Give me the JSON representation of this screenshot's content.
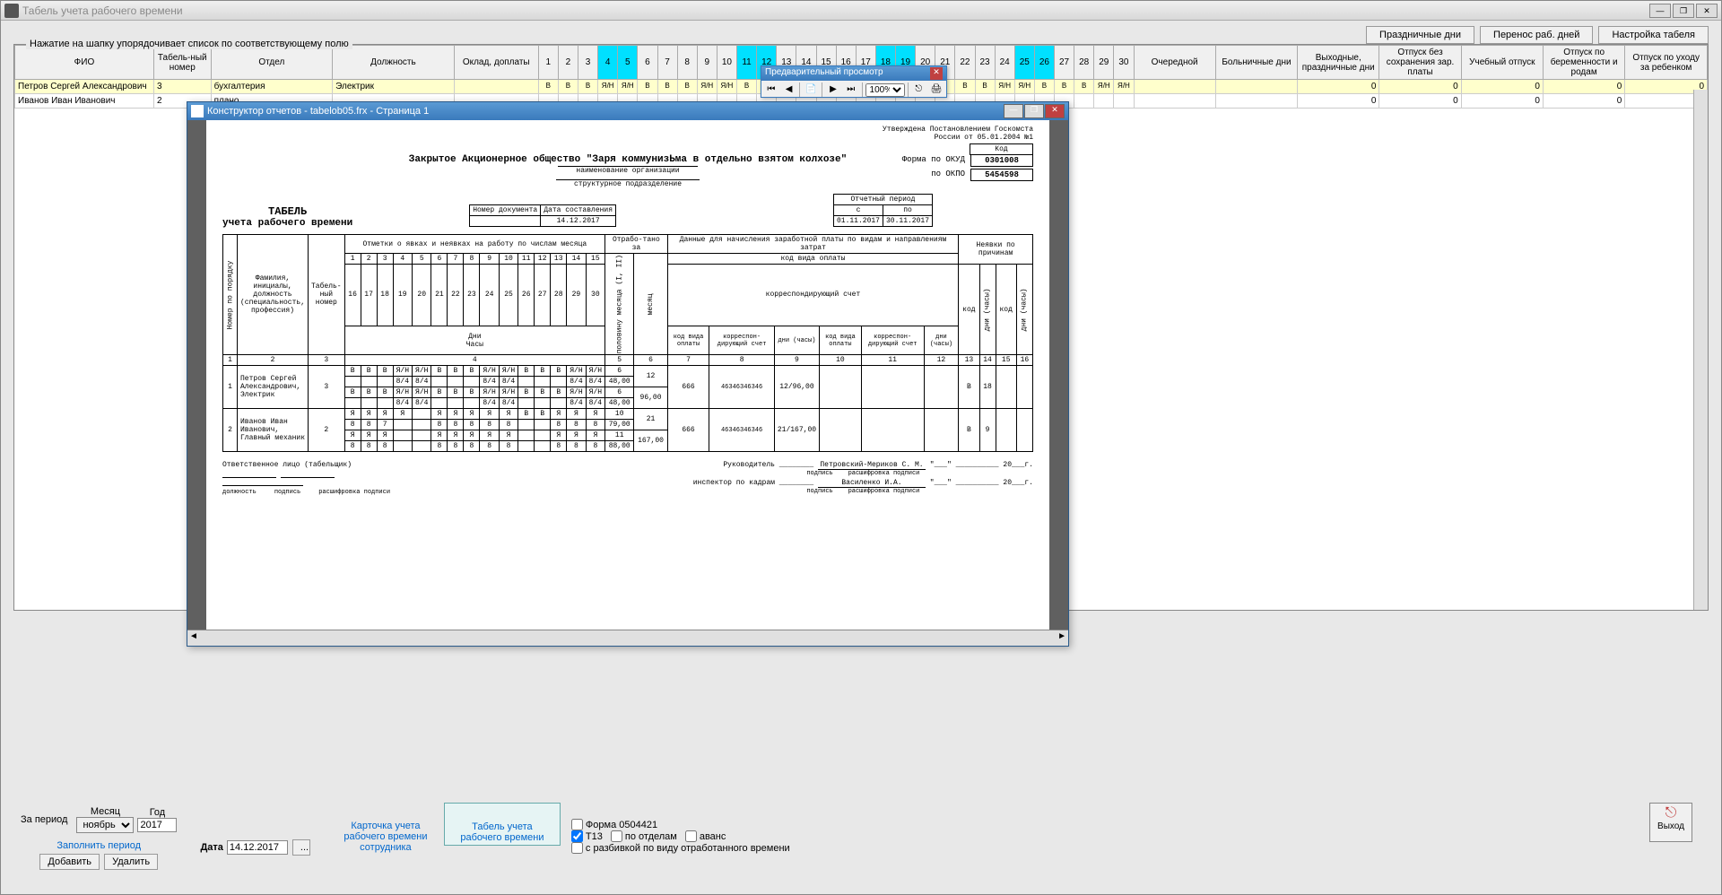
{
  "window": {
    "title": "Табель учета рабочего времени"
  },
  "topButtons": {
    "holidays": "Праздничные дни",
    "transfer": "Перенос раб. дней",
    "settings": "Настройка табеля"
  },
  "gridHint": "Нажатие на шапку упорядочивает список по соответствующему полю",
  "columns": {
    "fio": "ФИО",
    "tabnum": "Табель-ный номер",
    "dept": "Отдел",
    "position": "Должность",
    "salary": "Оклад, доплаты",
    "vacation": "Очередной",
    "sick": "Больничные дни",
    "weekend": "Выходные, праздничные дни",
    "unpaid": "Отпуск без сохранения зар. платы",
    "study": "Учебный отпуск",
    "maternity": "Отпуск по беременности и родам",
    "childcare": "Отпуск по уходу за ребенком"
  },
  "days": [
    "1",
    "2",
    "3",
    "4",
    "5",
    "6",
    "7",
    "8",
    "9",
    "10",
    "11",
    "12",
    "13",
    "14",
    "15",
    "16",
    "17",
    "18",
    "19",
    "20",
    "21",
    "22",
    "23",
    "24",
    "25",
    "26",
    "27",
    "28",
    "29",
    "30"
  ],
  "weekendDays": [
    4,
    5,
    11,
    12,
    18,
    19,
    25,
    26
  ],
  "rows": [
    {
      "fio": "Петров Сергей Александрович",
      "tabnum": "3",
      "dept": "бухгалтерия",
      "position": "Электрик",
      "marks": [
        "В",
        "В",
        "В",
        "Я/Н",
        "Я/Н",
        "В",
        "В",
        "В",
        "Я/Н",
        "Я/Н",
        "В",
        "В",
        "В",
        "Я/Н",
        "Я/Н",
        "В",
        "В",
        "В",
        "Я/Н",
        "Я/Н",
        "В",
        "В",
        "В",
        "Я/Н",
        "Я/Н",
        "В",
        "В",
        "В",
        "Я/Н",
        "Я/Н"
      ],
      "cats": [
        "",
        "",
        "0",
        "0",
        "0",
        "0",
        "0"
      ]
    },
    {
      "fio": "Иванов Иван Иванович",
      "tabnum": "2",
      "dept": "плано",
      "position": "",
      "marks": [
        "",
        "",
        "",
        "",
        "",
        "",
        "",
        "",
        "",
        "",
        "",
        "",
        "",
        "",
        "",
        "",
        "",
        "",
        "",
        "",
        "",
        "",
        "",
        "",
        "",
        "",
        "",
        "",
        "",
        ""
      ],
      "cats": [
        "",
        "",
        "0",
        "0",
        "0",
        "0",
        "0"
      ]
    }
  ],
  "period": {
    "label": "За период",
    "monthLabel": "Месяц",
    "yearLabel": "Год",
    "month": "ноябрь",
    "year": "2017",
    "fillBtn": "Заполнить период",
    "addBtn": "Добавить",
    "delBtn": "Удалить",
    "dateLabel": "Дата",
    "date": "14.12.2017",
    "ellipsis": "...",
    "cardLink": "Карточка учета рабочего времени сотрудника",
    "tabelLink": "Табель учета рабочего времени",
    "form": "Форма 0504421",
    "t13": "Т13",
    "byDept": "по отделам",
    "advance": "аванс",
    "byType": "с разбивкой по виду отработанного времени",
    "exit": "Выход"
  },
  "previewToolbar": {
    "title": "Предварительный просмотр",
    "zoom": "100%"
  },
  "reportWindow": {
    "title": "Конструктор отчетов - tabelob05.frx - Страница 1"
  },
  "report": {
    "approval1": "Утверждена Постановлением Госкомста",
    "approval2": "России от 05.01.2004 №1",
    "codeLabel": "Код",
    "okudLabel": "Форма по ОКУД",
    "okud": "0301008",
    "okpoLabel": "по ОКПО",
    "okpo": "5454598",
    "org": "Закрытое Акционерное общество \"Заря коммунизЬма в отдельно взятом колхозе\"",
    "orgSub": "наименование организации",
    "deptSub": "структурное подразделение",
    "title": "ТАБЕЛЬ",
    "subtitle": "учета рабочего времени",
    "docNumHdr": "Номер документа",
    "docDateHdr": "Дата составления",
    "periodHdr": "Отчетный период",
    "periodFrom": "с",
    "periodTo": "по",
    "docDate": "14.12.2017",
    "dateFrom": "01.11.2017",
    "dateTo": "30.11.2017",
    "thOrder": "Номер по порядку",
    "thFio": "Фамилия, инициалы, должность (специальность, профессия)",
    "thTabNum": "Табель-ный номер",
    "thMarks": "Отметки о явках и неявках на работу по числам месяца",
    "thWorked": "Отрабо-тано за",
    "thHalf": "половину месяца (I, II)",
    "thMonth": "месяц",
    "thPayData": "Данные для начисления заработной платы по видам и направлениям затрат",
    "thPayCode": "код вида оплаты",
    "thCorrAcct": "корреспондирующий счет",
    "thDays": "Дни",
    "thHours": "Часы",
    "thPayCode2": "код вида оплаты",
    "thCorr2": "корреспон-дирующий счет",
    "thDaysHours": "дни (часы)",
    "thAbsence": "Неявки по причинам",
    "thCode": "код",
    "cols": [
      "1",
      "2",
      "3",
      "4",
      "5",
      "6",
      "7",
      "8",
      "9",
      "10",
      "11",
      "12",
      "13",
      "14",
      "15"
    ],
    "cols2": [
      "16",
      "17",
      "18",
      "19",
      "20",
      "21",
      "22",
      "23",
      "24",
      "25",
      "26",
      "27",
      "28",
      "29",
      "30"
    ],
    "footerCols": [
      "1",
      "2",
      "3",
      "4",
      "5",
      "6",
      "7",
      "8",
      "9",
      "10",
      "11",
      "12",
      "13"
    ],
    "emp1": {
      "n": "1",
      "name": "Петров Сергей Александрович, Электрик",
      "tab": "3",
      "r1": [
        "В",
        "В",
        "В",
        "Я/Н",
        "Я/Н",
        "В",
        "В",
        "В",
        "Я/Н",
        "Я/Н",
        "В",
        "В",
        "В",
        "Я/Н",
        "Я/Н"
      ],
      "r1b": [
        "",
        "",
        "",
        "8/4",
        "8/4",
        "",
        "",
        "",
        "8/4",
        "8/4",
        "",
        "",
        "",
        "8/4",
        "8/4"
      ],
      "r2": [
        "В",
        "В",
        "В",
        "Я/Н",
        "Я/Н",
        "В",
        "В",
        "В",
        "Я/Н",
        "Я/Н",
        "В",
        "В",
        "В",
        "Я/Н",
        "Я/Н"
      ],
      "r2b": [
        "",
        "",
        "",
        "8/4",
        "8/4",
        "",
        "",
        "",
        "8/4",
        "8/4",
        "",
        "",
        "",
        "8/4",
        "8/4"
      ],
      "d1": "6",
      "h1": "48,00",
      "half": "12",
      "d2": "6",
      "h2": "48,00",
      "dm": "96,00",
      "code": "666",
      "acct": "46346346346",
      "dh": "12/96,00",
      "absCode": "В",
      "absDays": "18"
    },
    "emp2": {
      "n": "2",
      "name": "Иванов Иван Иванович, Главный механик",
      "tab": "2",
      "r1": [
        "Я",
        "Я",
        "Я",
        "Я",
        "",
        "Я",
        "Я",
        "Я",
        "Я",
        "Я",
        "В",
        "В",
        "Я",
        "Я",
        "Я"
      ],
      "r1b": [
        "8",
        "8",
        "7",
        "",
        "",
        "8",
        "8",
        "8",
        "8",
        "8",
        "",
        "",
        "8",
        "8",
        "8"
      ],
      "r2": [
        "Я",
        "Я",
        "Я",
        "",
        "",
        "Я",
        "Я",
        "Я",
        "Я",
        "Я",
        "",
        "",
        "Я",
        "Я",
        "Я"
      ],
      "r2b": [
        "8",
        "8",
        "8",
        "",
        "",
        "8",
        "8",
        "8",
        "8",
        "8",
        "",
        "",
        "8",
        "8",
        "8"
      ],
      "d1": "10",
      "h1": "79,00",
      "half": "21",
      "d2": "11",
      "h2": "88,00",
      "dm": "167,00",
      "code": "666",
      "acct": "46346346346",
      "dh": "21/167,00",
      "absCode": "В",
      "absDays": "9"
    },
    "sigResp": "Ответственное лицо (табельщик)",
    "sigPos": "должность",
    "sigSign": "подпись",
    "sigName": "расшифровка подписи",
    "sigHead": "Руководитель",
    "sigHeadName": "Петровский-Мериков С. М.",
    "sigHr": "инспектор по кадрам",
    "sigHrName": "Василенко И.А.",
    "sigDate": "\"___\" __________ 20___г."
  }
}
